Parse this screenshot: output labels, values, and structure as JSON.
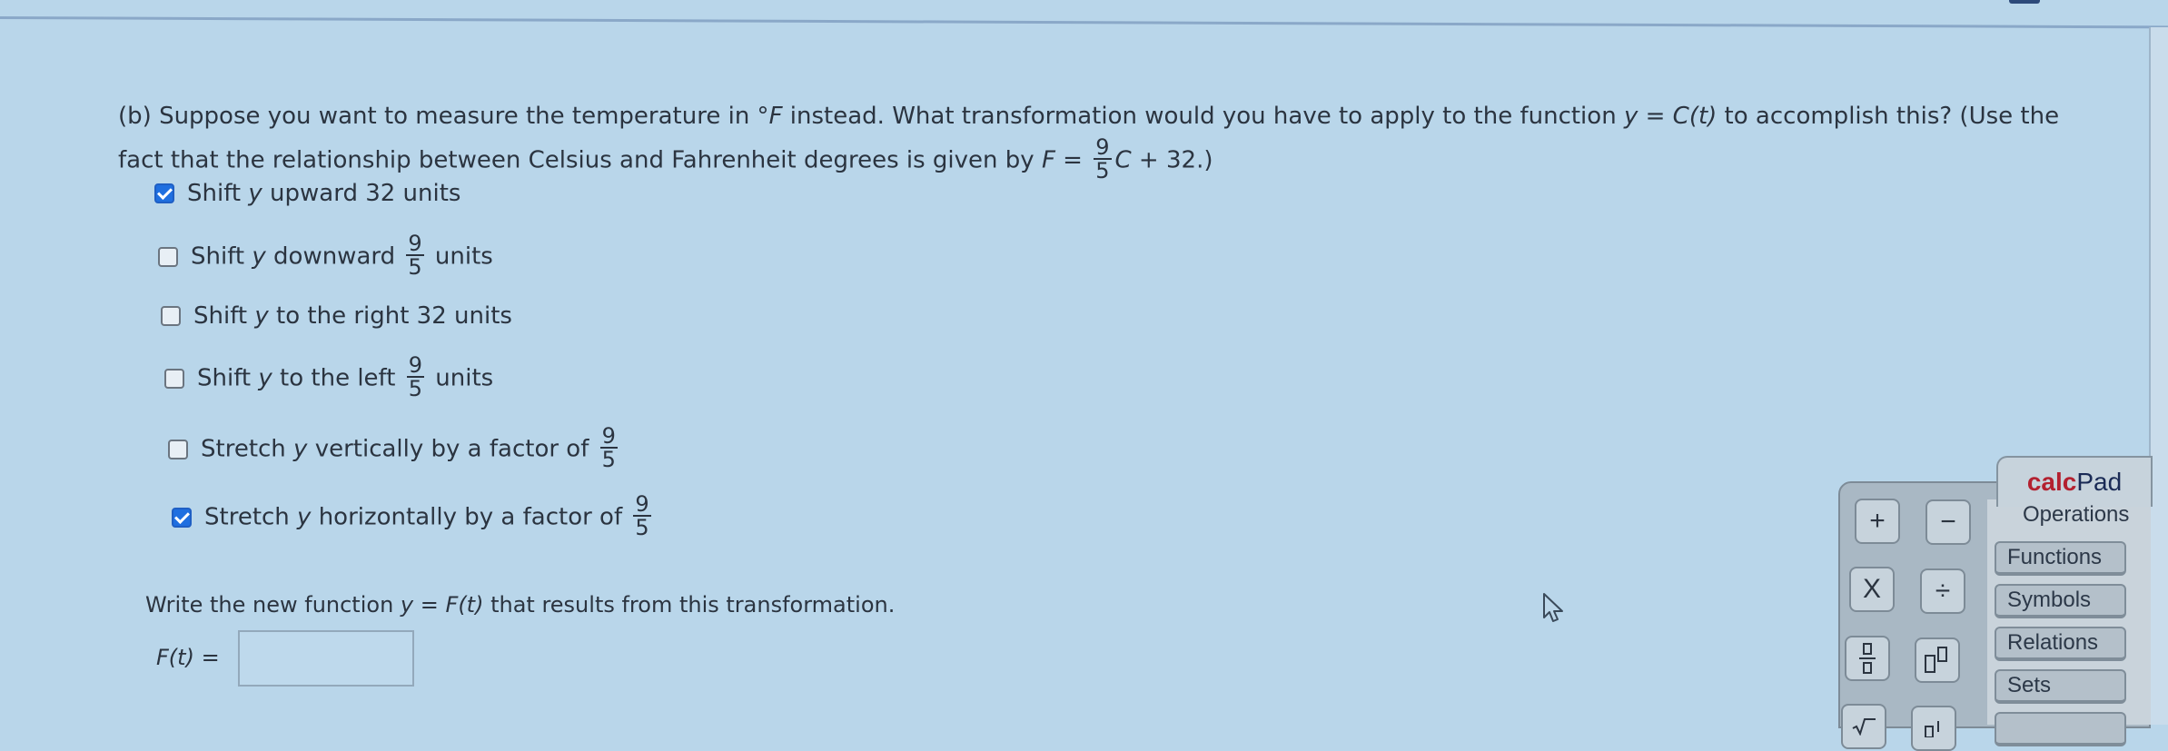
{
  "question": {
    "part_label": "(b)",
    "line1_a": "Suppose you want to measure the temperature in °",
    "line1_unit": "F",
    "line1_b": " instead. What transformation would you have to apply to the function ",
    "line1_fn_y": "y",
    "line1_fn_eq": " = ",
    "line1_fn_c": "C",
    "line1_fn_t": "(t)",
    "line1_c": " to accomplish this? (Use the",
    "line2_a": "fact that the relationship between Celsius and Fahrenheit degrees is given by ",
    "line2_F": "F",
    "line2_eq": " = ",
    "line2_num": "9",
    "line2_den": "5",
    "line2_C": "C",
    "line2_rest": " + 32.)"
  },
  "options": [
    {
      "pre": "Shift ",
      "var": "y",
      "post": " upward 32 units",
      "frac": null,
      "after": "",
      "checked": true
    },
    {
      "pre": "Shift ",
      "var": "y",
      "post": " downward ",
      "frac": {
        "num": "9",
        "den": "5"
      },
      "after": " units",
      "checked": false
    },
    {
      "pre": "Shift ",
      "var": "y",
      "post": " to the right 32 units",
      "frac": null,
      "after": "",
      "checked": false
    },
    {
      "pre": "Shift ",
      "var": "y",
      "post": " to the left ",
      "frac": {
        "num": "9",
        "den": "5"
      },
      "after": " units",
      "checked": false
    },
    {
      "pre": "Stretch ",
      "var": "y",
      "post": " vertically by a factor of ",
      "frac": {
        "num": "9",
        "den": "5"
      },
      "after": "",
      "checked": false
    },
    {
      "pre": "Stretch ",
      "var": "y",
      "post": " horizontally by a factor of ",
      "frac": {
        "num": "9",
        "den": "5"
      },
      "after": "",
      "checked": true
    }
  ],
  "write_prompt": {
    "a": "Write the new function ",
    "y": "y",
    "eq": " = ",
    "F": "F",
    "t": "(t)",
    "b": " that results from this transformation."
  },
  "answer": {
    "label_fn": "F(t)",
    "label_eq": " =",
    "value": ""
  },
  "calcpad": {
    "brand_red": "calc",
    "brand_blue": "Pad",
    "categories": [
      "Operations",
      "Functions",
      "Symbols",
      "Relations",
      "Sets"
    ],
    "active_category": "Operations",
    "keys": [
      "plus",
      "minus",
      "times",
      "divide",
      "fraction",
      "exponent",
      "sqrt",
      "subscript"
    ],
    "key_labels": {
      "plus": "+",
      "minus": "−",
      "times": "X",
      "divide": "÷"
    }
  },
  "colors": {
    "checkbox_checked": "#1f6fe0",
    "brand_red": "#b3202f",
    "brand_blue": "#1a2a55",
    "background": "#b9d6ea"
  }
}
